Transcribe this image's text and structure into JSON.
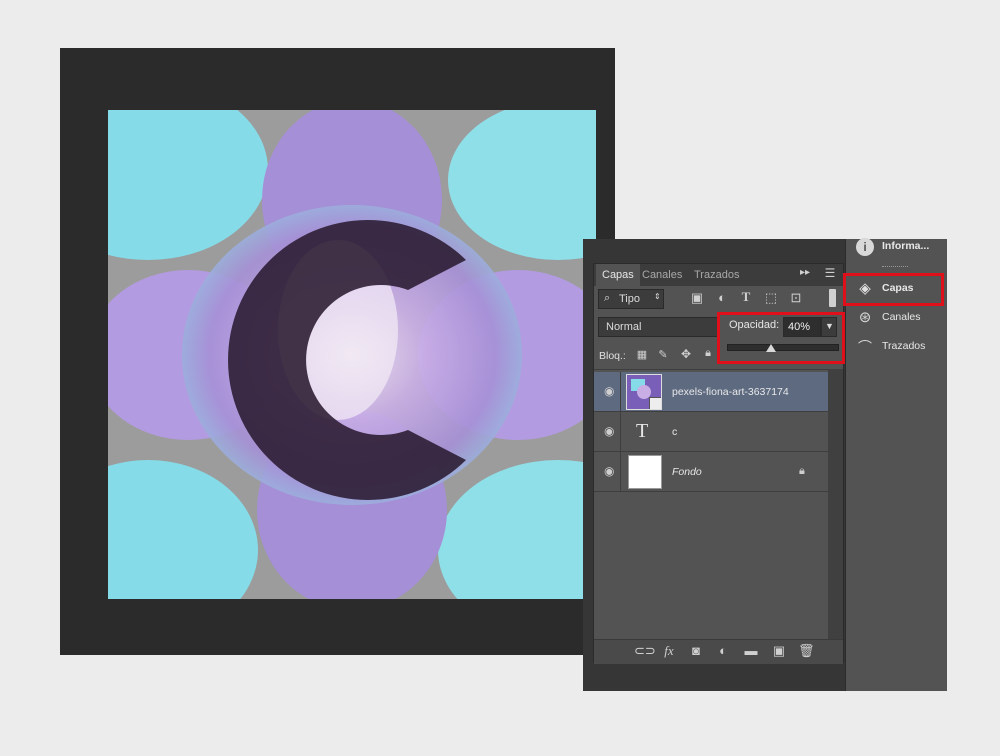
{
  "panel": {
    "tabs": [
      {
        "label": "Capas",
        "active": true
      },
      {
        "label": "Canales",
        "active": false
      },
      {
        "label": "Trazados",
        "active": false
      }
    ],
    "filter_kind": "Tipo",
    "blend_mode": "Normal",
    "opacity_label": "Opacidad:",
    "opacity_value": "40%",
    "opacity_fraction": 0.4,
    "lock_label": "Bloq.:",
    "layers": [
      {
        "name": "pexels-fiona-art-3637174",
        "type": "smart-object",
        "selected": true,
        "visible": true
      },
      {
        "name": "c",
        "type": "text",
        "selected": false,
        "visible": true
      },
      {
        "name": "Fondo",
        "type": "background",
        "selected": false,
        "visible": true,
        "locked": true
      }
    ],
    "footer_icons": [
      "link-icon",
      "fx-icon",
      "mask-icon",
      "adjustment-icon",
      "folder-icon",
      "new-layer-icon",
      "trash-icon"
    ]
  },
  "dock": {
    "items": [
      {
        "label": "Informa...",
        "icon": "info-icon"
      },
      {
        "label": "Capas",
        "icon": "layers-icon",
        "highlighted": true
      },
      {
        "label": "Canales",
        "icon": "channels-icon"
      },
      {
        "label": "Trazados",
        "icon": "paths-icon"
      }
    ]
  },
  "artwork": {
    "letter": "C",
    "colors": {
      "purple": "#a690d6",
      "cyan": "#86dbe8",
      "gray": "#9b9b9b",
      "dark": "#2a1a30"
    }
  },
  "highlight_color": "#e0101a"
}
